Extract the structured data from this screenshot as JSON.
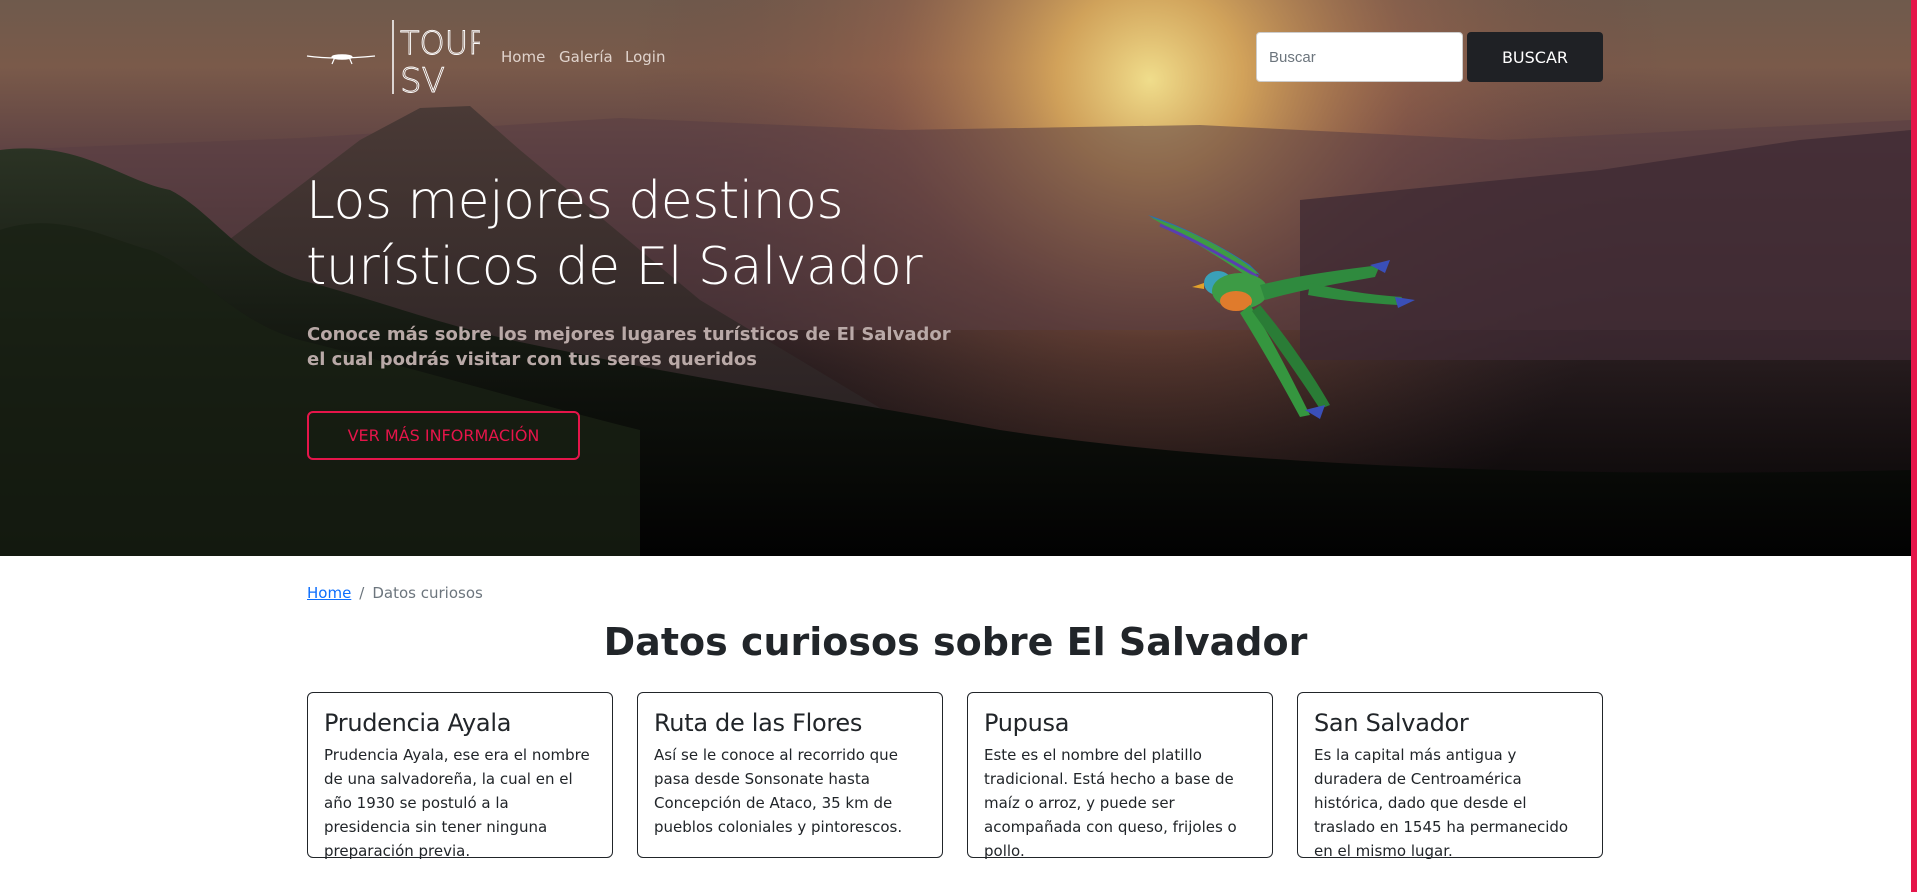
{
  "brand": {
    "logo_text_top": "TOUR",
    "logo_text_bottom": "SV"
  },
  "nav": {
    "links": [
      "Home",
      "Galería",
      "Login"
    ]
  },
  "search": {
    "placeholder": "Buscar",
    "button_label": "BUSCAR"
  },
  "hero": {
    "title_line1": "Los mejores destinos",
    "title_line2": "turísticos de El Salvador",
    "subtitle": "Conoce más sobre los mejores lugares turísticos de El Salvador el cual podrás visitar con tus seres queridos",
    "button_label": "VER MÁS INFORMACIÓN"
  },
  "breadcrumb": {
    "home": "Home",
    "separator": "/",
    "current": "Datos curiosos"
  },
  "section": {
    "title": "Datos curiosos sobre El Salvador"
  },
  "cards": [
    {
      "title": "Prudencia Ayala",
      "text": "Prudencia Ayala, ese era el nombre de una salvadoreña, la cual en el año 1930 se postuló a la presidencia sin tener ninguna preparación previa."
    },
    {
      "title": "Ruta de las Flores",
      "text": "Así se le conoce al recorrido que pasa desde Sonsonate hasta Concepción de Ataco, 35 km de pueblos coloniales y pintorescos."
    },
    {
      "title": "Pupusa",
      "text": "Este es el nombre del platillo tradicional. Está hecho a base de maíz o arroz, y puede ser acompañada con queso, frijoles o pollo."
    },
    {
      "title": "San Salvador",
      "text": "Es la capital más antigua y duradera de Centroamérica histórica, dado que desde el traslado en 1545 ha permanecido en el mismo lugar."
    }
  ],
  "colors": {
    "accent": "#e5154a",
    "dark_button": "#1f2125",
    "link": "#0d6efd"
  }
}
